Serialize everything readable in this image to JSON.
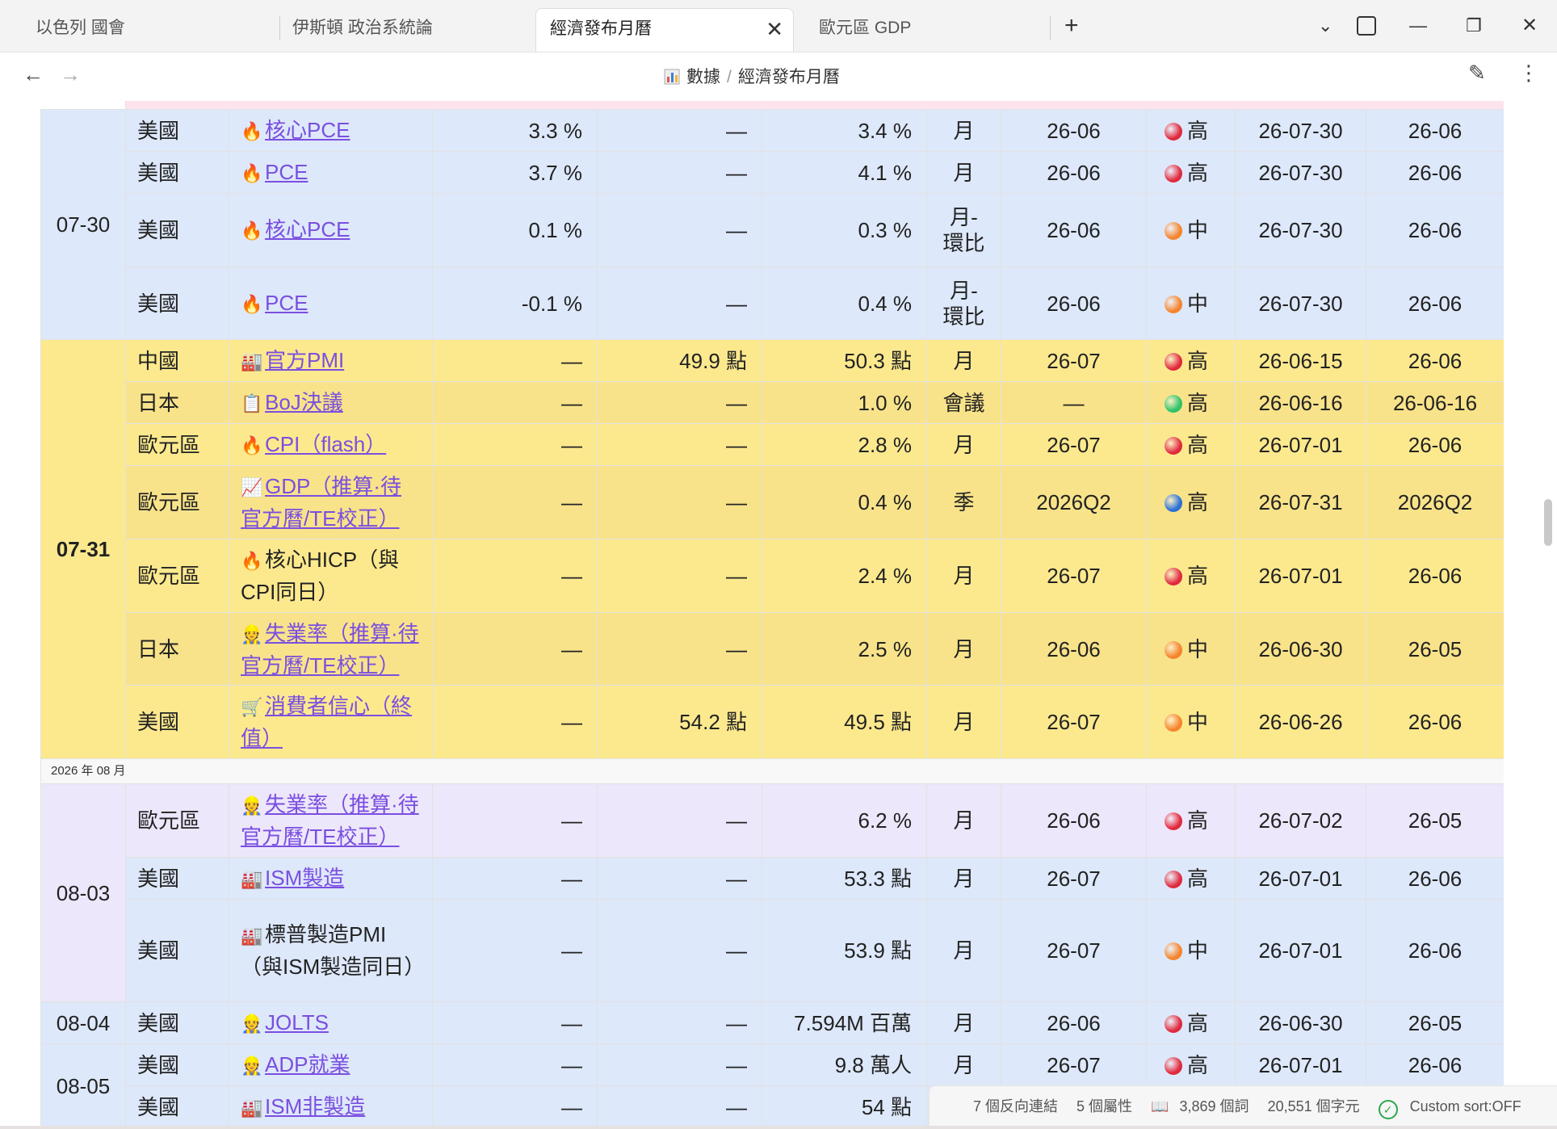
{
  "tabs": [
    {
      "label": "以色列 國會"
    },
    {
      "label": "伊斯頓 政治系統論"
    },
    {
      "label": "經濟發布月曆"
    },
    {
      "label": "歐元區 GDP"
    }
  ],
  "window": {
    "new_tab": "+",
    "dropdown": "⌄",
    "minimize": "—",
    "restore": "❐",
    "close": "✕",
    "tab_close": "✕"
  },
  "nav": {
    "back": "←",
    "forward": "→",
    "crumb_root": "數據",
    "crumb_sep": "/",
    "crumb_page": "經濟發布月曆",
    "edit_icon": "✎",
    "more_icon": "⋮"
  },
  "colors": {
    "yellow_row": "#fce98e",
    "blue_row": "#dde8fa",
    "purple_row": "#ede7fb",
    "link": "#7a4fe0"
  },
  "month_header": "2026 年 08 月",
  "rows": [
    {
      "date": "07-30",
      "country": "美國",
      "icon": "🔥",
      "name": "核心PCE",
      "link": true,
      "actual": "3.3 %",
      "forecast": "—",
      "previous": "3.4 %",
      "freq": "月",
      "period": "26-06",
      "impact_color": "#e0293e",
      "impact": "高",
      "next": "26-07-30",
      "ref": "26-06"
    },
    {
      "country": "美國",
      "icon": "🔥",
      "name": "PCE",
      "link": true,
      "actual": "3.7 %",
      "forecast": "—",
      "previous": "4.1 %",
      "freq": "月",
      "period": "26-06",
      "impact_color": "#e0293e",
      "impact": "高",
      "next": "26-07-30",
      "ref": "26-06"
    },
    {
      "country": "美國",
      "icon": "🔥",
      "name": "核心PCE",
      "link": true,
      "actual": "0.1 %",
      "forecast": "—",
      "previous": "0.3 %",
      "freq": "月-環比",
      "period": "26-06",
      "impact_color": "#f5842c",
      "impact": "中",
      "next": "26-07-30",
      "ref": "26-06"
    },
    {
      "country": "美國",
      "icon": "🔥",
      "name": "PCE",
      "link": true,
      "actual": "-0.1 %",
      "forecast": "—",
      "previous": "0.4 %",
      "freq": "月-環比",
      "period": "26-06",
      "impact_color": "#f5842c",
      "impact": "中",
      "next": "26-07-30",
      "ref": "26-06"
    },
    {
      "date": "07-31",
      "country": "中國",
      "icon": "🏭",
      "name": "官方PMI",
      "link": true,
      "actual": "—",
      "forecast": "49.9 點",
      "previous": "50.3 點",
      "freq": "月",
      "period": "26-07",
      "impact_color": "#e0293e",
      "impact": "高",
      "next": "26-06-15",
      "ref": "26-06"
    },
    {
      "country": "日本",
      "icon": "📋",
      "name": "BoJ決議",
      "link": true,
      "actual": "—",
      "forecast": "—",
      "previous": "1.0 %",
      "freq": "會議",
      "period": "—",
      "impact_color": "#2ec26a",
      "impact": "高",
      "next": "26-06-16",
      "ref": "26-06-16"
    },
    {
      "country": "歐元區",
      "icon": "🔥",
      "name": "CPI（flash）",
      "link": true,
      "actual": "—",
      "forecast": "—",
      "previous": "2.8 %",
      "freq": "月",
      "period": "26-07",
      "impact_color": "#e0293e",
      "impact": "高",
      "next": "26-07-01",
      "ref": "26-06"
    },
    {
      "country": "歐元區",
      "icon": "📈",
      "name": "GDP（推算·待官方曆/TE校正）",
      "link": true,
      "actual": "—",
      "forecast": "—",
      "previous": "0.4 %",
      "freq": "季",
      "period": "2026Q2",
      "impact_color": "#2b6fd6",
      "impact": "高",
      "next": "26-07-31",
      "ref": "2026Q2"
    },
    {
      "country": "歐元區",
      "icon": "🔥",
      "name": "核心HICP（與CPI同日）",
      "link": false,
      "actual": "—",
      "forecast": "—",
      "previous": "2.4 %",
      "freq": "月",
      "period": "26-07",
      "impact_color": "#e0293e",
      "impact": "高",
      "next": "26-07-01",
      "ref": "26-06"
    },
    {
      "country": "日本",
      "icon": "👷",
      "name": "失業率（推算·待官方曆/TE校正）",
      "link": true,
      "actual": "—",
      "forecast": "—",
      "previous": "2.5 %",
      "freq": "月",
      "period": "26-06",
      "impact_color": "#f5842c",
      "impact": "中",
      "next": "26-06-30",
      "ref": "26-05"
    },
    {
      "country": "美國",
      "icon": "🛒",
      "name": "消費者信心（終值）",
      "link": true,
      "actual": "—",
      "forecast": "54.2 點",
      "previous": "49.5 點",
      "freq": "月",
      "period": "26-07",
      "impact_color": "#f5842c",
      "impact": "中",
      "next": "26-06-26",
      "ref": "26-06"
    },
    {
      "date": "08-03",
      "country": "歐元區",
      "icon": "👷",
      "name": "失業率（推算·待官方曆/TE校正）",
      "link": true,
      "actual": "—",
      "forecast": "—",
      "previous": "6.2 %",
      "freq": "月",
      "period": "26-06",
      "impact_color": "#e0293e",
      "impact": "高",
      "next": "26-07-02",
      "ref": "26-05"
    },
    {
      "country": "美國",
      "icon": "🏭",
      "name": "ISM製造",
      "link": true,
      "actual": "—",
      "forecast": "—",
      "previous": "53.3 點",
      "freq": "月",
      "period": "26-07",
      "impact_color": "#e0293e",
      "impact": "高",
      "next": "26-07-01",
      "ref": "26-06"
    },
    {
      "country": "美國",
      "icon": "🏭",
      "name": "標普製造PMI（與ISM製造同日）",
      "link": false,
      "actual": "—",
      "forecast": "—",
      "previous": "53.9 點",
      "freq": "月",
      "period": "26-07",
      "impact_color": "#f5842c",
      "impact": "中",
      "next": "26-07-01",
      "ref": "26-06"
    },
    {
      "date": "08-04",
      "country": "美國",
      "icon": "👷",
      "name": "JOLTS",
      "link": true,
      "actual": "—",
      "forecast": "—",
      "previous": "7.594M 百萬",
      "freq": "月",
      "period": "26-06",
      "impact_color": "#e0293e",
      "impact": "高",
      "next": "26-06-30",
      "ref": "26-05"
    },
    {
      "date": "08-05",
      "country": "美國",
      "icon": "👷",
      "name": "ADP就業",
      "link": true,
      "actual": "—",
      "forecast": "—",
      "previous": "9.8 萬人",
      "freq": "月",
      "period": "26-07",
      "impact_color": "#e0293e",
      "impact": "高",
      "next": "26-07-01",
      "ref": "26-06"
    },
    {
      "country": "美國",
      "icon": "🏭",
      "name": "ISM非製造",
      "link": true,
      "actual": "—",
      "forecast": "—",
      "previous": "54 點",
      "freq": "月",
      "period": "26-07",
      "impact_color": "#e0293e",
      "impact": "高",
      "next": "26-07-01",
      "ref": "26-06"
    }
  ],
  "status": {
    "backlinks": "7 個反向連結",
    "properties": "5 個屬性",
    "book_icon": "📖",
    "words": "3,869 個詞",
    "chars": "20,551 個字元",
    "sort": "Custom sort:OFF"
  }
}
